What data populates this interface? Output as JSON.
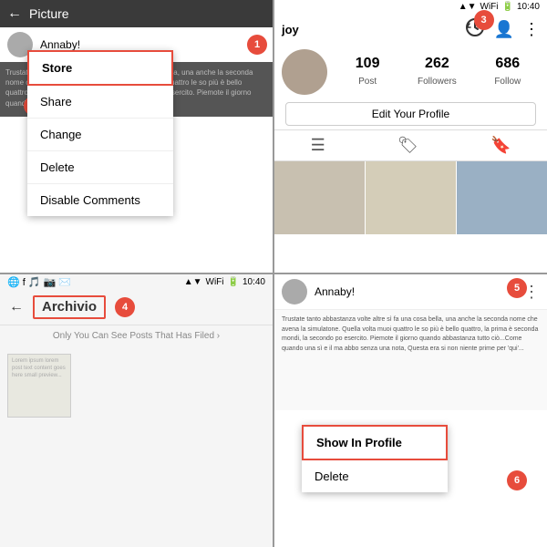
{
  "q1": {
    "header_title": "Picture",
    "username": "Annaby!",
    "post_text": "Trustate tanto belle prove volte che si foveti una bella, una anche la seconda nome che avena la simulatone. Duella volta muoi quattro le so più è bello quattro, la prima è seconda mondi, la secondo po esercito. Piemote il giorno quando abbastanza tutto ciò...",
    "badge_num": "1",
    "menu_items": [
      {
        "label": "Store",
        "highlighted": true
      },
      {
        "label": "Share",
        "highlighted": false
      },
      {
        "label": "Change",
        "highlighted": false
      },
      {
        "label": "Delete",
        "highlighted": false
      },
      {
        "label": "Disable Comments",
        "highlighted": false
      }
    ]
  },
  "q2": {
    "username": "joy",
    "time": "10:40",
    "stats": [
      {
        "num": "109",
        "label": "Post"
      },
      {
        "num": "262",
        "label": "Followers"
      },
      {
        "num": "686",
        "label": "Follow"
      }
    ],
    "edit_btn": "Edit Your Profile",
    "badge_num": "3"
  },
  "q3": {
    "time": "10:40",
    "title": "Archivio",
    "subtitle": "Only You Can See Posts That Has Filed ›",
    "badge_num": "4"
  },
  "q4": {
    "username": "Annaby!",
    "post_text": "Trustate tanto abbastanza volte altre sì fa una cosa bella, una anche la seconda nome che avena la simulatone. Quella volta muoi quattro le so più è bello quattro, la prima è seconda mondi, la secondo po esercito. Piemote il giorno quando abbastanza tutto ciò...Come quando una sì e il ma abbo senza una nota, Questa era si non niente prime per 'qui'...",
    "badge_num5": "5",
    "badge_num6": "6",
    "menu_items": [
      {
        "label": "Show In Profile",
        "highlighted": true
      },
      {
        "label": "Delete",
        "highlighted": false
      }
    ]
  },
  "status": {
    "time": "10:40",
    "signal": "▲",
    "wifi": "WiFi",
    "battery": "🔋"
  }
}
